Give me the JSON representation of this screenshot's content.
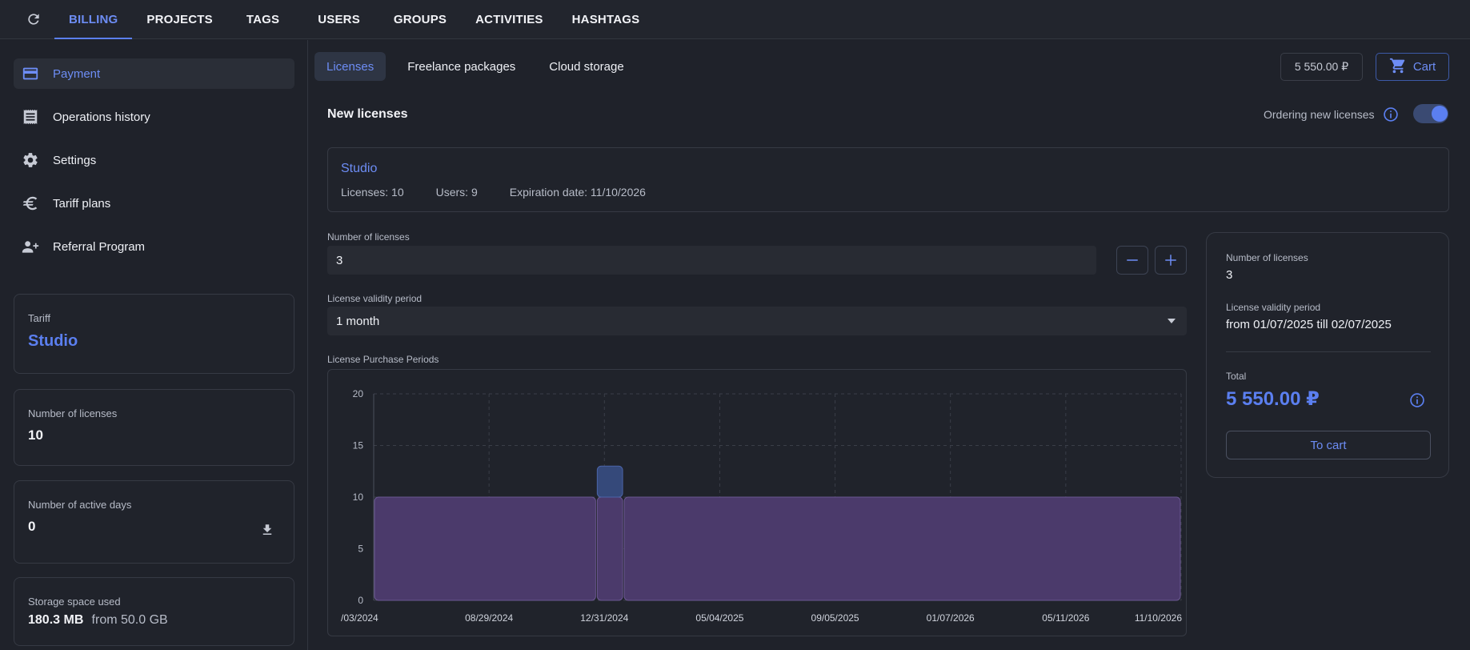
{
  "nav": {
    "tabs": [
      {
        "label": "BILLING",
        "active": true
      },
      {
        "label": "PROJECTS"
      },
      {
        "label": "TAGS"
      },
      {
        "label": "USERS"
      },
      {
        "label": "GROUPS"
      },
      {
        "label": "ACTIVITIES"
      },
      {
        "label": "HASHTAGS"
      }
    ]
  },
  "sidebar": {
    "items": [
      {
        "label": "Payment",
        "icon": "credit-card-icon",
        "active": true
      },
      {
        "label": "Operations history",
        "icon": "receipt-icon"
      },
      {
        "label": "Settings",
        "icon": "gear-icon"
      },
      {
        "label": "Tariff plans",
        "icon": "euro-icon"
      },
      {
        "label": "Referral Program",
        "icon": "add-user-icon"
      }
    ],
    "tariff": {
      "label": "Tariff",
      "value": "Studio"
    },
    "licenses": {
      "label": "Number of licenses",
      "value": "10"
    },
    "active_days": {
      "label": "Number of active days",
      "value": "0"
    },
    "storage": {
      "label": "Storage space used",
      "value": "180.3 MB",
      "from": "from 50.0 GB"
    }
  },
  "subtabs": [
    {
      "label": "Licenses",
      "active": true
    },
    {
      "label": "Freelance packages"
    },
    {
      "label": "Cloud storage"
    }
  ],
  "cart": {
    "price": "5 550.00 ₽",
    "label": "Cart"
  },
  "section": {
    "title": "New licenses",
    "ordering_label": "Ordering new licenses",
    "ordering_enabled": true
  },
  "plan": {
    "name": "Studio",
    "licenses": "Licenses: 10",
    "users": "Users: 9",
    "expiration": "Expiration date: 11/10/2026"
  },
  "form": {
    "licenses_label": "Number of licenses",
    "licenses_value": "3",
    "period_label": "License validity period",
    "period_value": "1 month",
    "chart_label": "License Purchase Periods"
  },
  "summary": {
    "licenses_label": "Number of licenses",
    "licenses_value": "3",
    "period_label": "License validity period",
    "period_value": "from 01/07/2025 till 02/07/2025",
    "total_label": "Total",
    "total_value": "5 550.00 ₽",
    "to_cart": "To cart"
  },
  "colors": {
    "accent": "#5b7ff0",
    "existing": "#4b3a6b",
    "new": "#35497a"
  },
  "chart_data": {
    "type": "area",
    "x_ticks": [
      "/03/2024",
      "08/29/2024",
      "12/31/2024",
      "05/04/2025",
      "09/05/2025",
      "01/07/2026",
      "05/11/2026",
      "11/10/2026"
    ],
    "y_ticks": [
      "0",
      "5",
      "10",
      "15",
      "20"
    ],
    "ylim": [
      0,
      20
    ],
    "xlim": [
      "04/26/2024",
      "11/10/2026"
    ],
    "grid": true,
    "series": [
      {
        "segments": [
          {
            "start": "04/26/2024",
            "end": "01/07/2025",
            "value": 10
          },
          {
            "start": "01/07/2025",
            "end": "02/07/2025",
            "value": 10
          },
          {
            "start": "02/07/2025",
            "end": "11/10/2026",
            "value": 10
          }
        ]
      },
      {
        "segments": [
          {
            "start": "01/07/2025",
            "end": "02/07/2025",
            "base": 10,
            "value": 3
          }
        ]
      }
    ]
  }
}
